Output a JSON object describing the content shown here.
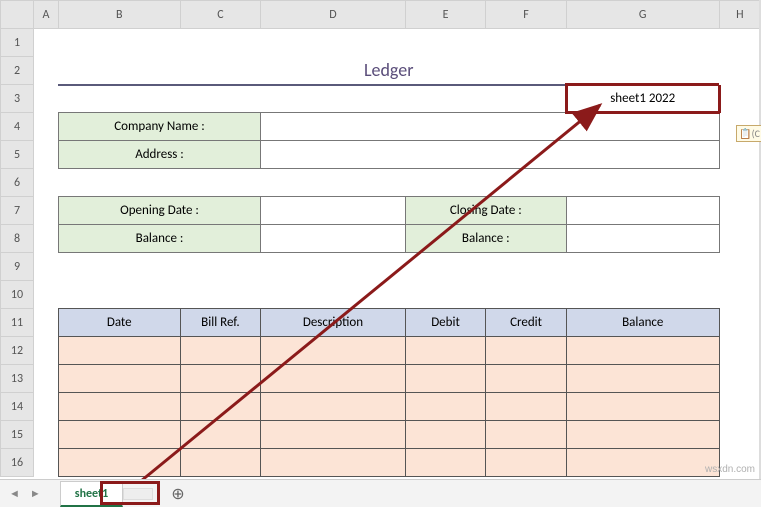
{
  "columns": [
    "A",
    "B",
    "C",
    "D",
    "E",
    "F",
    "G",
    "H"
  ],
  "rows": [
    "1",
    "2",
    "3",
    "4",
    "5",
    "6",
    "7",
    "8",
    "9",
    "10",
    "11",
    "12",
    "13",
    "14",
    "15",
    "16"
  ],
  "title": "Ledger",
  "sheet_badge": "sheet1 2022",
  "section1": {
    "company_label": "Company Name :",
    "address_label": "Address :",
    "company_value": "",
    "address_value": ""
  },
  "section2": {
    "opening_date_label": "Opening Date :",
    "opening_balance_label": "Balance :",
    "closing_date_label": "Closing Date :",
    "closing_balance_label": "Balance :",
    "opening_date_value": "",
    "opening_balance_value": "",
    "closing_date_value": "",
    "closing_balance_value": ""
  },
  "table_headers": {
    "date": "Date",
    "bill_ref": "Bill Ref.",
    "description": "Description",
    "debit": "Debit",
    "credit": "Credit",
    "balance": "Balance"
  },
  "chart_data": {
    "type": "table",
    "columns": [
      "Date",
      "Bill Ref.",
      "Description",
      "Debit",
      "Credit",
      "Balance"
    ],
    "rows": [
      [
        "",
        "",
        "",
        "",
        "",
        ""
      ],
      [
        "",
        "",
        "",
        "",
        "",
        ""
      ],
      [
        "",
        "",
        "",
        "",
        "",
        ""
      ],
      [
        "",
        "",
        "",
        "",
        "",
        ""
      ],
      [
        "",
        "",
        "",
        "",
        "",
        ""
      ]
    ]
  },
  "tabs": {
    "active": "sheet1",
    "second": ""
  },
  "nav": {
    "prev": "◄",
    "next": "►"
  },
  "add_tab": "⊕",
  "watermark": "wsxdn.com",
  "paste_hint": "(C"
}
